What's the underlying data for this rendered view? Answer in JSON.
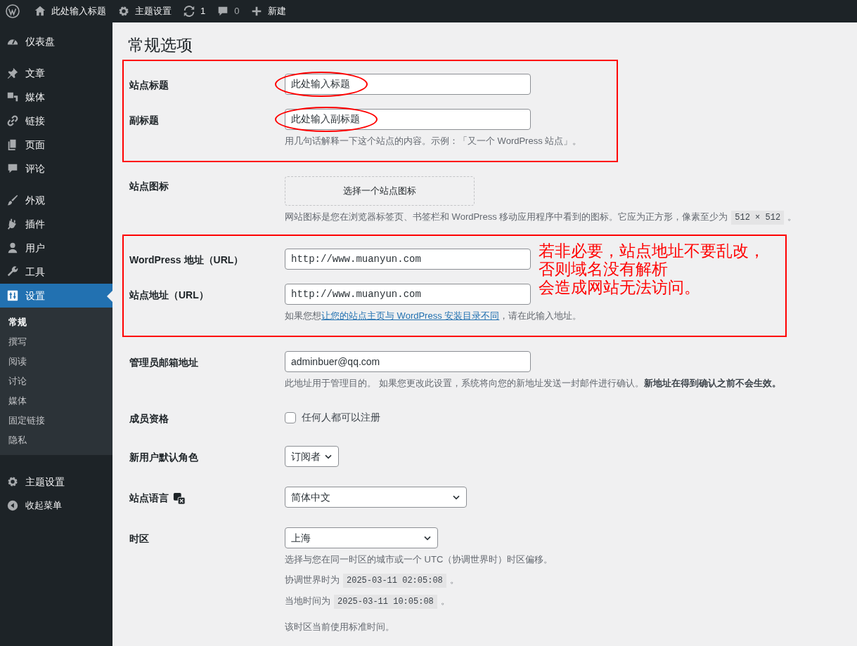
{
  "admin_bar": [
    {
      "kind": "logo"
    },
    {
      "kind": "home",
      "label": "此处输入标题"
    },
    {
      "kind": "gear",
      "label": "主题设置"
    },
    {
      "kind": "updates",
      "label": "1"
    },
    {
      "kind": "comments",
      "label": "0"
    },
    {
      "kind": "new",
      "label": "新建"
    }
  ],
  "sidebar": {
    "groups": [
      {
        "items": [
          {
            "label": "仪表盘",
            "selected": false
          }
        ]
      },
      {
        "items": [
          {
            "label": "文章",
            "selected": false
          },
          {
            "label": "媒体",
            "selected": false
          },
          {
            "label": "链接",
            "selected": false
          },
          {
            "label": "页面",
            "selected": false
          },
          {
            "label": "评论",
            "selected": false
          }
        ]
      },
      {
        "items": [
          {
            "label": "外观",
            "selected": false
          },
          {
            "label": "插件",
            "selected": false
          },
          {
            "label": "用户",
            "selected": false
          },
          {
            "label": "工具",
            "selected": false
          },
          {
            "label": "设置",
            "selected": true,
            "children": [
              {
                "label": "常规",
                "selected": true
              },
              {
                "label": "撰写",
                "selected": false
              },
              {
                "label": "阅读",
                "selected": false
              },
              {
                "label": "讨论",
                "selected": false
              },
              {
                "label": "媒体",
                "selected": false
              },
              {
                "label": "固定链接",
                "selected": false
              },
              {
                "label": "隐私",
                "selected": false
              }
            ]
          }
        ]
      },
      {
        "items": [
          {
            "label": "主题设置",
            "selected": false
          },
          {
            "label": "收起菜单",
            "selected": false
          }
        ]
      }
    ]
  },
  "page_title": "常规选项",
  "sections": [
    {
      "highlighted": true,
      "rows": [
        {
          "kind": "text",
          "label": "站点标题",
          "value": "此处输入标题",
          "circled": true
        },
        {
          "kind": "text",
          "label": "副标题",
          "value": "此处输入副标题",
          "circled": true,
          "description": [
            {
              "kind": "text",
              "text": "用几句话解释一下这个站点的内容。示例：「又一个 WordPress 站点」。"
            }
          ]
        }
      ]
    },
    {
      "highlighted": false,
      "rows": [
        {
          "kind": "icon_picker",
          "label": "站点图标",
          "button": "选择一个站点图标",
          "description": [
            {
              "kind": "text",
              "text": "网站图标是您在浏览器标签页、书签栏和 WordPress 移动应用程序中看到的图标。它应为正方形，像素至少为"
            },
            {
              "kind": "code",
              "text": "512 × 512"
            },
            {
              "kind": "text",
              "text": "。"
            }
          ]
        }
      ]
    },
    {
      "highlighted": true,
      "note": [
        "若非必要，站点地址不要乱改，",
        "否则域名没有解析",
        "会造成网站无法访问。"
      ],
      "rows": [
        {
          "kind": "url",
          "label": "WordPress 地址（URL）",
          "value": "http://www.muanyun.com"
        },
        {
          "kind": "url",
          "label": "站点地址（URL）",
          "value": "http://www.muanyun.com",
          "description": [
            {
              "kind": "text",
              "text": "如果您想"
            },
            {
              "kind": "link",
              "text": "让您的站点主页与 WordPress 安装目录不同"
            },
            {
              "kind": "text",
              "text": "，请在此输入地址。"
            }
          ]
        }
      ]
    },
    {
      "highlighted": false,
      "rows": [
        {
          "kind": "text",
          "label": "管理员邮箱地址",
          "value": "adminbuer@qq.com",
          "description": [
            {
              "kind": "text",
              "text": "此地址用于管理目的。 如果您更改此设置，系统将向您的新地址发送一封邮件进行确认。"
            },
            {
              "kind": "bold",
              "text": "新地址在得到确认之前不会生效。"
            }
          ]
        },
        {
          "kind": "checkbox",
          "label": "成员资格",
          "option": "任何人都可以注册",
          "checked": false
        },
        {
          "kind": "select",
          "label": "新用户默认角色",
          "value": "订阅者"
        },
        {
          "kind": "select",
          "label": "站点语言",
          "label_icon": true,
          "value": "简体中文"
        },
        {
          "kind": "select",
          "label": "时区",
          "value": "上海",
          "description": [
            {
              "kind": "text",
              "text": "选择与您在同一时区的城市或一个 UTC（协调世界时）时区偏移。"
            }
          ],
          "notes": [
            [
              {
                "kind": "text",
                "text": "协调世界时为"
              },
              {
                "kind": "code",
                "text": "2025-03-11 02:05:08"
              },
              {
                "kind": "text",
                "text": "。"
              }
            ],
            [
              {
                "kind": "text",
                "text": "当地时间为"
              },
              {
                "kind": "code",
                "text": "2025-03-11 10:05:08"
              },
              {
                "kind": "text",
                "text": "。"
              }
            ],
            [
              {
                "kind": "text",
                "text": "该时区当前使用标准时间。"
              }
            ]
          ]
        }
      ]
    }
  ]
}
